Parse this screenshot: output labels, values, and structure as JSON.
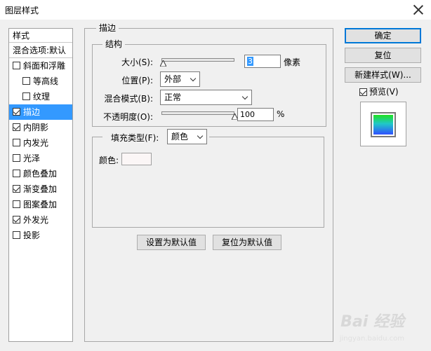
{
  "window": {
    "title": "图层样式"
  },
  "style_list": {
    "header": "样式",
    "blending": "混合选项:默认",
    "items": [
      {
        "label": "斜面和浮雕",
        "checked": false,
        "indent": false,
        "selected": false
      },
      {
        "label": "等高线",
        "checked": false,
        "indent": true,
        "selected": false
      },
      {
        "label": "纹理",
        "checked": false,
        "indent": true,
        "selected": false
      },
      {
        "label": "描边",
        "checked": true,
        "indent": false,
        "selected": true
      },
      {
        "label": "内阴影",
        "checked": true,
        "indent": false,
        "selected": false
      },
      {
        "label": "内发光",
        "checked": false,
        "indent": false,
        "selected": false
      },
      {
        "label": "光泽",
        "checked": false,
        "indent": false,
        "selected": false
      },
      {
        "label": "颜色叠加",
        "checked": false,
        "indent": false,
        "selected": false
      },
      {
        "label": "渐变叠加",
        "checked": true,
        "indent": false,
        "selected": false
      },
      {
        "label": "图案叠加",
        "checked": false,
        "indent": false,
        "selected": false
      },
      {
        "label": "外发光",
        "checked": true,
        "indent": false,
        "selected": false
      },
      {
        "label": "投影",
        "checked": false,
        "indent": false,
        "selected": false
      }
    ]
  },
  "stroke": {
    "title": "描边",
    "structure": {
      "title": "结构",
      "size_label": "大小(S):",
      "size_value": "3",
      "size_unit": "像素",
      "position_label": "位置(P):",
      "position_value": "外部",
      "blend_label": "混合模式(B):",
      "blend_value": "正常",
      "opacity_label": "不透明度(O):",
      "opacity_value": "100",
      "opacity_unit": "%",
      "size_slider_level": 0.02,
      "opacity_slider_level": 1.0
    },
    "fill": {
      "type_label": "填充类型(F):",
      "type_value": "颜色",
      "color_label": "颜色:",
      "color_value": "#fbf6f6"
    },
    "set_default": "设置为默认值",
    "reset_default": "复位为默认值"
  },
  "buttons": {
    "ok": "确定",
    "reset": "复位",
    "new_style": "新建样式(W)...",
    "preview_label": "预览(V)",
    "preview_checked": true
  },
  "watermark": {
    "main": "Bai 经验",
    "sub": "jingyan.baidu.com"
  },
  "icons": {
    "close": "close-icon",
    "checkbox": "checkbox-icon",
    "dropdown": "chevron-down-icon",
    "slider": "slider-thumb-icon"
  }
}
